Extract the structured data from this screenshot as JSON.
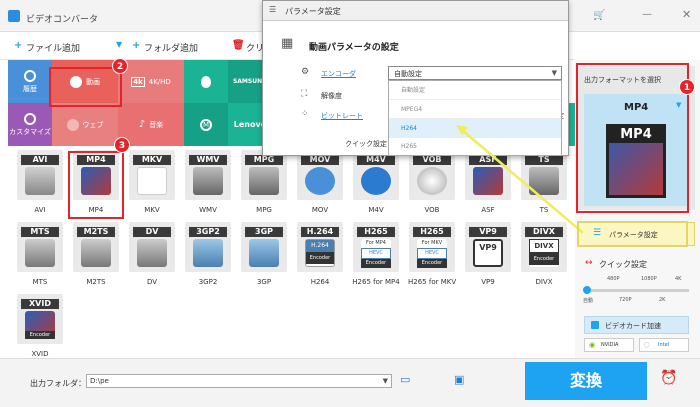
{
  "app": {
    "title": "ビデオコンバータ"
  },
  "toolbar": {
    "add_file": "ファイル追加",
    "add_folder": "フォルダ追加",
    "clear": "クリア"
  },
  "categories": {
    "history": "履歴",
    "customize": "カスタマイズ",
    "video": "動画",
    "web": "ウェブ",
    "k4": "4K/HD",
    "music": "音楽",
    "samsung": "SAMSUNG",
    "lenovo": "Lenovo"
  },
  "formats_row1": [
    "AVI",
    "MP4",
    "MKV",
    "WMV",
    "MPG",
    "MOV",
    "M4V",
    "VOB",
    "ASF",
    "TS"
  ],
  "formats_row2": [
    "MTS",
    "M2TS",
    "DV",
    "3GP2",
    "3GP",
    "H264",
    "H265 for MP4",
    "H265 for MKV",
    "VP9",
    "DIVX"
  ],
  "formats_row2_band": [
    "MTS",
    "M2TS",
    "DV",
    "3GP2",
    "3GP",
    "H.264",
    "H265",
    "H265",
    "VP9",
    "DIVX"
  ],
  "formats_row2_sub": [
    "",
    "",
    "",
    "",
    "",
    "H.264",
    "For MP4",
    "For MKV",
    "",
    ""
  ],
  "formats_row3": [
    "XVID"
  ],
  "encoder_tag": "Encoder",
  "hevc_tag": "HEVC",
  "badges": {
    "one": "1",
    "two": "2",
    "three": "3"
  },
  "dialog": {
    "title": "パラメータ設定",
    "header": "動画パラメータの設定",
    "encoder_label": "エンコーダ",
    "resolution_label": "解像度",
    "bitrate_label": "ビットレート",
    "quick_setting_partial": "クイック設定",
    "encoder_value": "自動設定",
    "options": [
      "自動設定",
      "MPEG4",
      "H264",
      "H265"
    ],
    "right_truncated": "定"
  },
  "right_panel": {
    "select_format": "出力フォーマットを選択",
    "format": "MP4",
    "param_button": "パラメータ設定",
    "quick_setting": "クイック設定",
    "quality_top": [
      "480P",
      "1080P",
      "4K"
    ],
    "quality_bottom": [
      "自動",
      "720P",
      "2K"
    ],
    "gpu_accel": "ビデオカード加速",
    "nvidia": "NVIDIA",
    "intel": "Intel"
  },
  "bottom": {
    "output_label": "出力フォルダ：",
    "output_path": "D:\\pe",
    "convert": "変換"
  }
}
